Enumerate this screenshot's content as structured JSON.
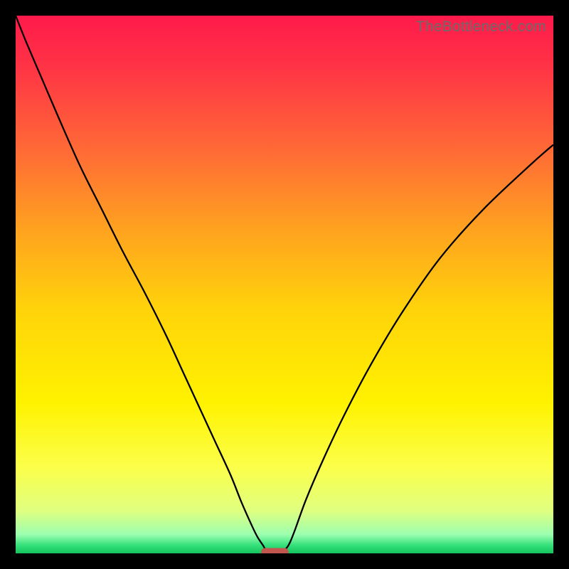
{
  "watermark": "TheBottleneck.com",
  "chart_data": {
    "type": "line",
    "title": "",
    "xlabel": "",
    "ylabel": "",
    "xlim": [
      0,
      100
    ],
    "ylim": [
      0,
      100
    ],
    "background_gradient": {
      "stops": [
        {
          "offset": 0,
          "color": "#ff1a4b"
        },
        {
          "offset": 0.1,
          "color": "#ff3545"
        },
        {
          "offset": 0.25,
          "color": "#ff6a36"
        },
        {
          "offset": 0.4,
          "color": "#ffa31f"
        },
        {
          "offset": 0.55,
          "color": "#ffd40a"
        },
        {
          "offset": 0.72,
          "color": "#fff200"
        },
        {
          "offset": 0.84,
          "color": "#fbff4a"
        },
        {
          "offset": 0.92,
          "color": "#e0ff7f"
        },
        {
          "offset": 0.965,
          "color": "#9cffb0"
        },
        {
          "offset": 0.985,
          "color": "#34e07a"
        },
        {
          "offset": 1.0,
          "color": "#14c35e"
        }
      ]
    },
    "series": [
      {
        "name": "curve",
        "color": "#000000",
        "width": 2.3,
        "x": [
          0,
          2,
          5,
          8,
          12,
          16,
          20,
          24,
          28,
          31,
          34,
          37,
          40,
          42,
          44,
          45,
          46,
          46.5,
          47.3,
          49.2,
          50.3,
          51,
          52,
          54,
          57,
          61,
          66,
          72,
          79,
          87,
          96,
          100
        ],
        "y": [
          100,
          95,
          88,
          81,
          72,
          64,
          56,
          48.5,
          40.5,
          34,
          27.5,
          21,
          14.5,
          9.5,
          5,
          3,
          1.5,
          0.7,
          0.2,
          0.2,
          0.9,
          2,
          4.5,
          10,
          17,
          25.5,
          35,
          45,
          55,
          64,
          72.5,
          76
        ]
      }
    ],
    "marker": {
      "type": "bar",
      "x_center": 48.2,
      "y": 0.25,
      "width": 5.1,
      "height": 1.5,
      "fill": "#c1574f",
      "rx": 0.75
    }
  }
}
